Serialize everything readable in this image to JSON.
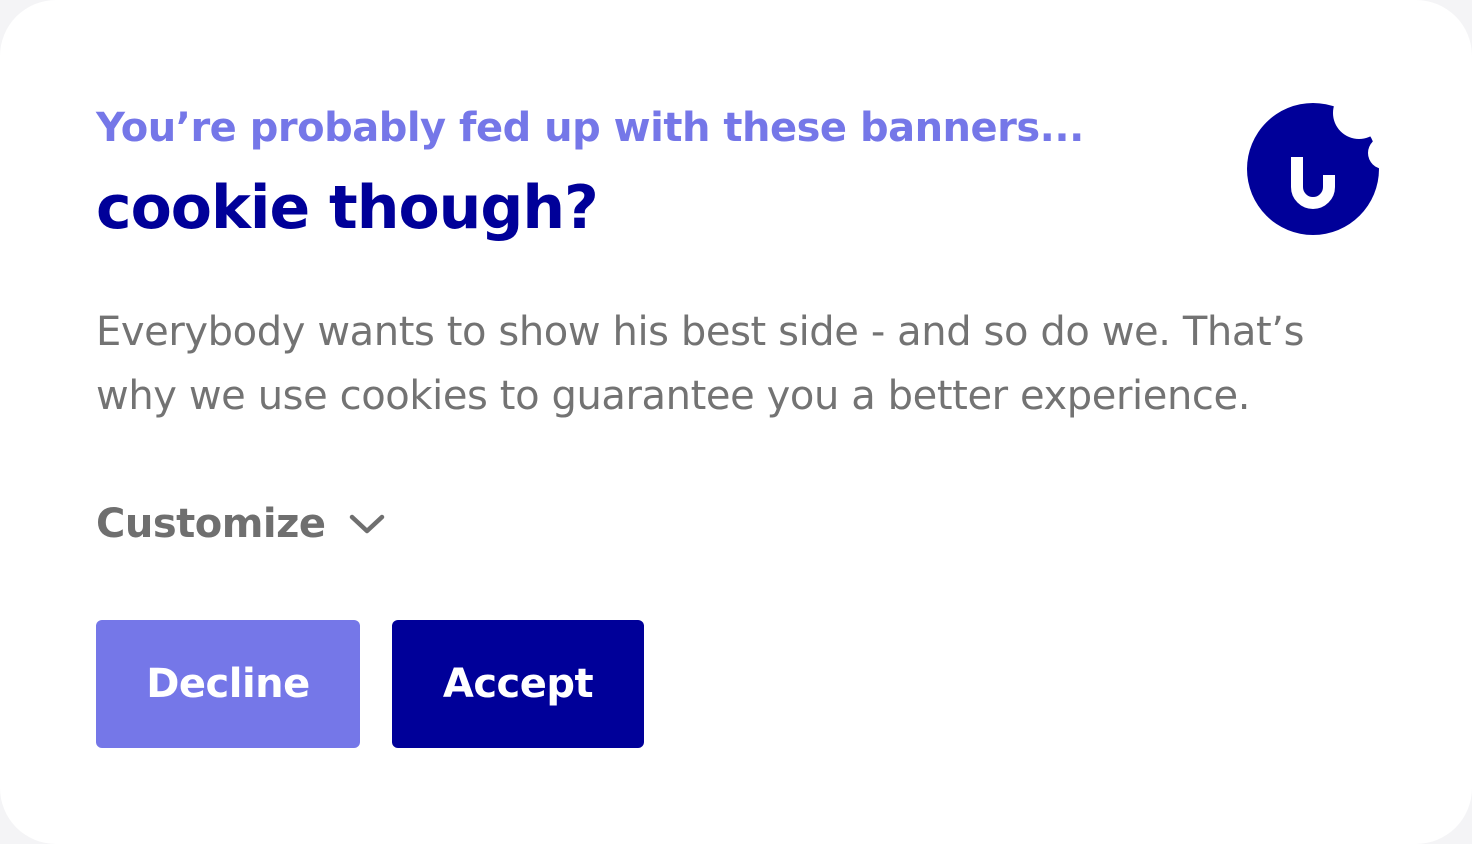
{
  "banner": {
    "eyebrow": "You’re probably fed up with these banners...",
    "title": "cookie though?",
    "body": "Everybody wants to show his best side - and so do we. That’s why we use cookies to guarantee you a better experience.",
    "customize_label": "Customize",
    "logo_icon": "bitten-cookie-logo-icon",
    "customize_icon": "chevron-down-icon"
  },
  "buttons": {
    "decline_label": "Decline",
    "accept_label": "Accept"
  },
  "colors": {
    "primary": "#000099",
    "secondary": "#7577e8",
    "text_muted": "#737373",
    "background": "#ffffff"
  }
}
